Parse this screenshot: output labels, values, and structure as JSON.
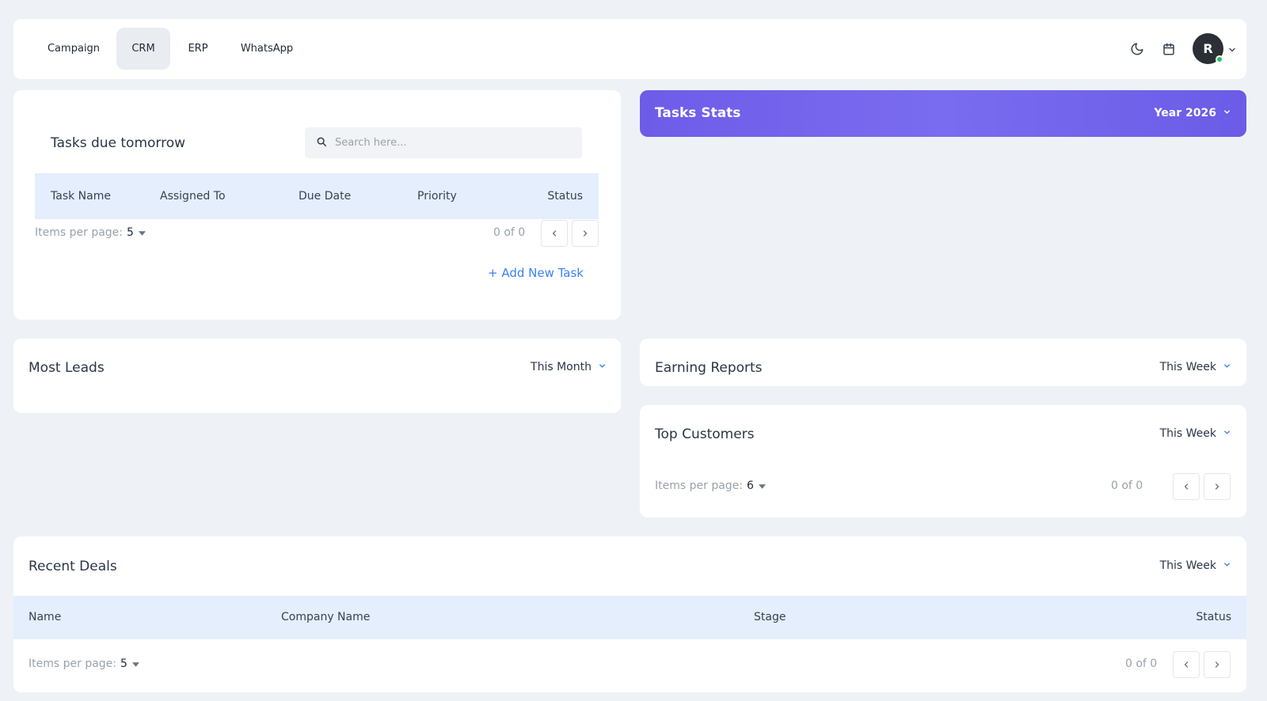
{
  "nav": {
    "tabs": [
      {
        "label": "Campaign",
        "active": false
      },
      {
        "label": "CRM",
        "active": true
      },
      {
        "label": "ERP",
        "active": false
      },
      {
        "label": "WhatsApp",
        "active": false
      }
    ],
    "icons": [
      "moon-icon",
      "calendar-icon"
    ],
    "avatar_initial": "R"
  },
  "tasks": {
    "title": "Tasks due tomorrow",
    "search_placeholder": "Search here...",
    "columns": [
      "Task Name",
      "Assigned To",
      "Due Date",
      "Priority",
      "Status"
    ],
    "pager": {
      "label": "Items per page:",
      "size": "5",
      "count": "0 of 0"
    },
    "add_label": "+ Add New Task"
  },
  "stats": {
    "title": "Tasks Stats",
    "period": "Year 2026"
  },
  "leads": {
    "title": "Most Leads",
    "period": "This Month"
  },
  "earning": {
    "title": "Earning Reports",
    "period": "This Week"
  },
  "customers": {
    "title": "Top Customers",
    "period": "This Week",
    "pager": {
      "label": "Items per page:",
      "size": "6",
      "count": "0 of 0"
    }
  },
  "deals": {
    "title": "Recent Deals",
    "period": "This Week",
    "columns": [
      "Name",
      "Company Name",
      "Stage",
      "Status"
    ],
    "pager": {
      "label": "Items per page:",
      "size": "5",
      "count": "0 of 0"
    }
  },
  "colors": {
    "accent": "#6d5ce8",
    "link": "#3b82f6",
    "table_header": "#e4eefc",
    "status_online": "#22c55e"
  }
}
